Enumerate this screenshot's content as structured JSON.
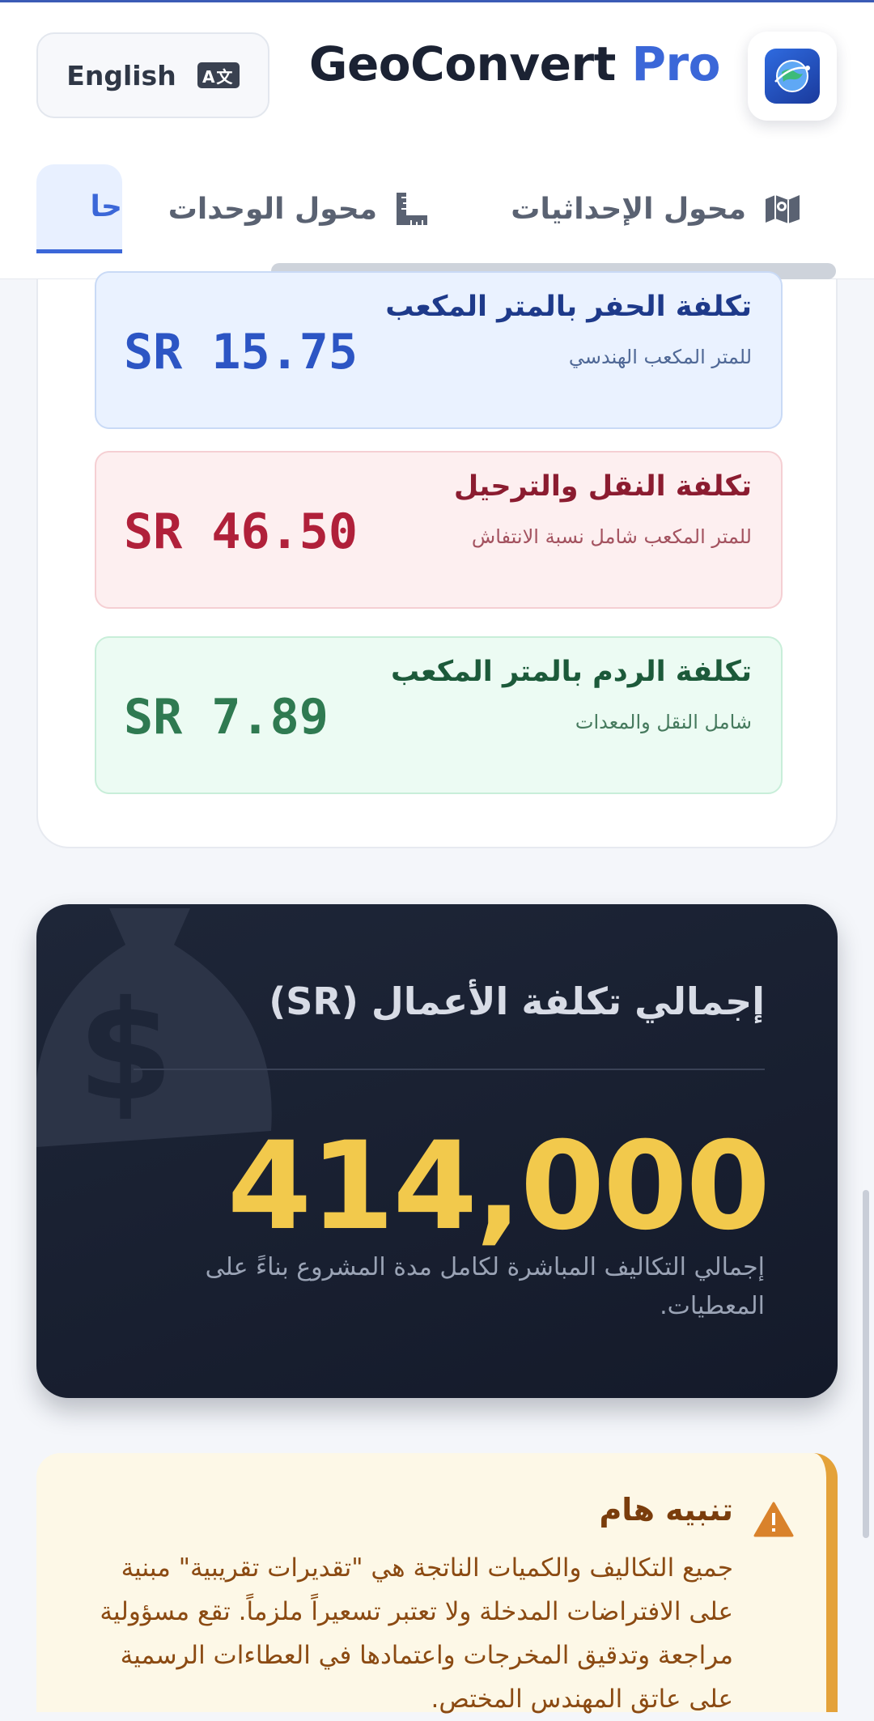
{
  "header": {
    "brand_main": "GeoConvert",
    "brand_accent": "Pro",
    "lang_button": "English",
    "lang_icon_text": "A文"
  },
  "tabs": [
    {
      "label": "محول الإحداثيات",
      "icon": "map-icon"
    },
    {
      "label": "محول الوحدات",
      "icon": "ruler-icon"
    },
    {
      "label": "حا",
      "icon": "",
      "active": true
    }
  ],
  "costs": {
    "excavation": {
      "title": "تكلفة الحفر بالمتر المكعب",
      "subtitle": "للمتر المكعب الهندسي",
      "value": "SR 15.75"
    },
    "transport": {
      "title": "تكلفة النقل والترحيل",
      "subtitle": "للمتر المكعب شامل نسبة الانتفاش",
      "value": "SR 46.50"
    },
    "backfill": {
      "title": "تكلفة الردم بالمتر المكعب",
      "subtitle": "شامل النقل والمعدات",
      "value": "SR 7.89"
    }
  },
  "total": {
    "title": "إجمالي تكلفة الأعمال (SR)",
    "amount": "414,000",
    "note": "إجمالي التكاليف المباشرة لكامل مدة المشروع بناءً على المعطيات."
  },
  "warning": {
    "title": "تنبيه هام",
    "text": "جميع التكاليف والكميات الناتجة هي \"تقديرات تقريبية\" مبنية على الافتراضات المدخلة ولا تعتبر تسعيراً ملزماً. تقع مسؤولية مراجعة وتدقيق المخرجات واعتمادها في العطاءات الرسمية على عاتق المهندس المختص."
  },
  "colors": {
    "accent": "#3b67d8",
    "total_bg": "#1a2133",
    "total_amount": "#f2c94c",
    "warning_border": "#e4a239"
  }
}
